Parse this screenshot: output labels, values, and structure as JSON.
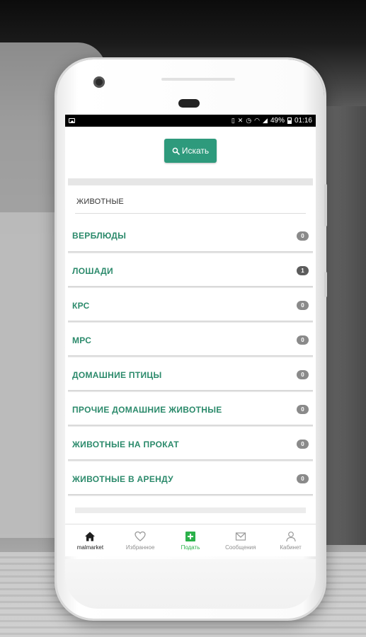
{
  "status_bar": {
    "battery": "49%",
    "time": "01:16"
  },
  "search": {
    "label": "Искать"
  },
  "section": {
    "title": "ЖИВОТНЫЕ"
  },
  "categories": [
    {
      "label": "ВЕРБЛЮДЫ",
      "count": "0"
    },
    {
      "label": "ЛОШАДИ",
      "count": "1"
    },
    {
      "label": "КРС",
      "count": "0"
    },
    {
      "label": "МРС",
      "count": "0"
    },
    {
      "label": "ДОМАШНИЕ ПТИЦЫ",
      "count": "0"
    },
    {
      "label": "ПРОЧИЕ ДОМАШНИЕ ЖИВОТНЫЕ",
      "count": "0"
    },
    {
      "label": "ЖИВОТНЫЕ НА ПРОКАТ",
      "count": "0"
    },
    {
      "label": "ЖИВОТНЫЕ В АРЕНДУ",
      "count": "0"
    }
  ],
  "bottom_nav": [
    {
      "label": "malmarket",
      "icon": "home-icon"
    },
    {
      "label": "Избранное",
      "icon": "heart-icon"
    },
    {
      "label": "Подать",
      "icon": "plus-square-icon"
    },
    {
      "label": "Сообщения",
      "icon": "envelope-icon"
    },
    {
      "label": "Кабинет",
      "icon": "user-icon"
    }
  ],
  "colors": {
    "accent": "#2e9a7c",
    "category_text": "#2b8a6b",
    "add_green": "#2bb14a",
    "badge": "#8a8a8a"
  }
}
